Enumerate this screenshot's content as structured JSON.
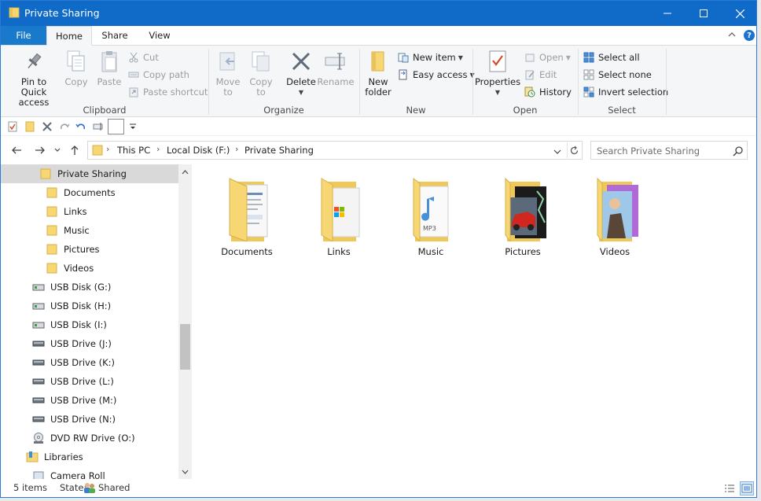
{
  "window": {
    "title": "Private Sharing",
    "buttons": {
      "minimize": "—",
      "maximize": "☐",
      "close": "✕"
    }
  },
  "ribbon_tabs": {
    "file": "File",
    "home": "Home",
    "share": "Share",
    "view": "View"
  },
  "help": "?",
  "ribbon": {
    "clipboard": {
      "label": "Clipboard",
      "pin_line1": "Pin to Quick",
      "pin_line2": "access",
      "copy": "Copy",
      "paste": "Paste",
      "cut": "Cut",
      "copy_path": "Copy path",
      "paste_shortcut": "Paste shortcut"
    },
    "organize": {
      "label": "Organize",
      "move_to_line1": "Move",
      "move_to_line2": "to",
      "copy_to_line1": "Copy",
      "copy_to_line2": "to",
      "delete": "Delete",
      "rename": "Rename"
    },
    "new": {
      "label": "New",
      "new_folder_line1": "New",
      "new_folder_line2": "folder",
      "new_item": "New item",
      "easy_access": "Easy access"
    },
    "open": {
      "label": "Open",
      "properties": "Properties",
      "open": "Open",
      "edit": "Edit",
      "history": "History"
    },
    "select": {
      "label": "Select",
      "select_all": "Select all",
      "select_none": "Select none",
      "invert_selection": "Invert selection"
    }
  },
  "address": {
    "crumbs": [
      "This PC",
      "Local Disk  (F:)",
      "Private Sharing"
    ],
    "chevron": "›"
  },
  "search": {
    "placeholder": "Search Private Sharing"
  },
  "nav_pane": {
    "items": [
      {
        "label": "Private Sharing",
        "icon": "folder-icon"
      },
      {
        "label": "Documents",
        "icon": "folder-icon"
      },
      {
        "label": "Links",
        "icon": "folder-icon"
      },
      {
        "label": "Music",
        "icon": "folder-icon"
      },
      {
        "label": "Pictures",
        "icon": "folder-icon"
      },
      {
        "label": "Videos",
        "icon": "folder-icon"
      },
      {
        "label": "USB Disk (G:)",
        "icon": "usb-disk-icon"
      },
      {
        "label": "USB Disk (H:)",
        "icon": "usb-disk-icon"
      },
      {
        "label": "USB Disk (I:)",
        "icon": "usb-disk-icon"
      },
      {
        "label": "USB Drive (J:)",
        "icon": "usb-drive-icon"
      },
      {
        "label": "USB Drive (K:)",
        "icon": "usb-drive-icon"
      },
      {
        "label": "USB Drive (L:)",
        "icon": "usb-drive-icon"
      },
      {
        "label": "USB Drive (M:)",
        "icon": "usb-drive-icon"
      },
      {
        "label": "USB Drive (N:)",
        "icon": "usb-drive-icon"
      },
      {
        "label": "DVD RW Drive (O:)",
        "icon": "dvd-drive-icon"
      },
      {
        "label": "Libraries",
        "icon": "libraries-icon"
      },
      {
        "label": "Camera Roll",
        "icon": "library-folder-icon"
      }
    ]
  },
  "files": [
    {
      "label": "Documents",
      "icon": "documents-folder-icon"
    },
    {
      "label": "Links",
      "icon": "links-folder-icon"
    },
    {
      "label": "Music",
      "icon": "music-folder-icon"
    },
    {
      "label": "Pictures",
      "icon": "pictures-folder-icon"
    },
    {
      "label": "Videos",
      "icon": "videos-folder-icon"
    }
  ],
  "status": {
    "count": "5 items",
    "state_label": "State:",
    "state_value": "Shared"
  },
  "colors": {
    "titlebar": "#0f6ac8",
    "file_tab": "#1979ca",
    "selection": "#d9d9d9",
    "folder": "#f7d774"
  }
}
